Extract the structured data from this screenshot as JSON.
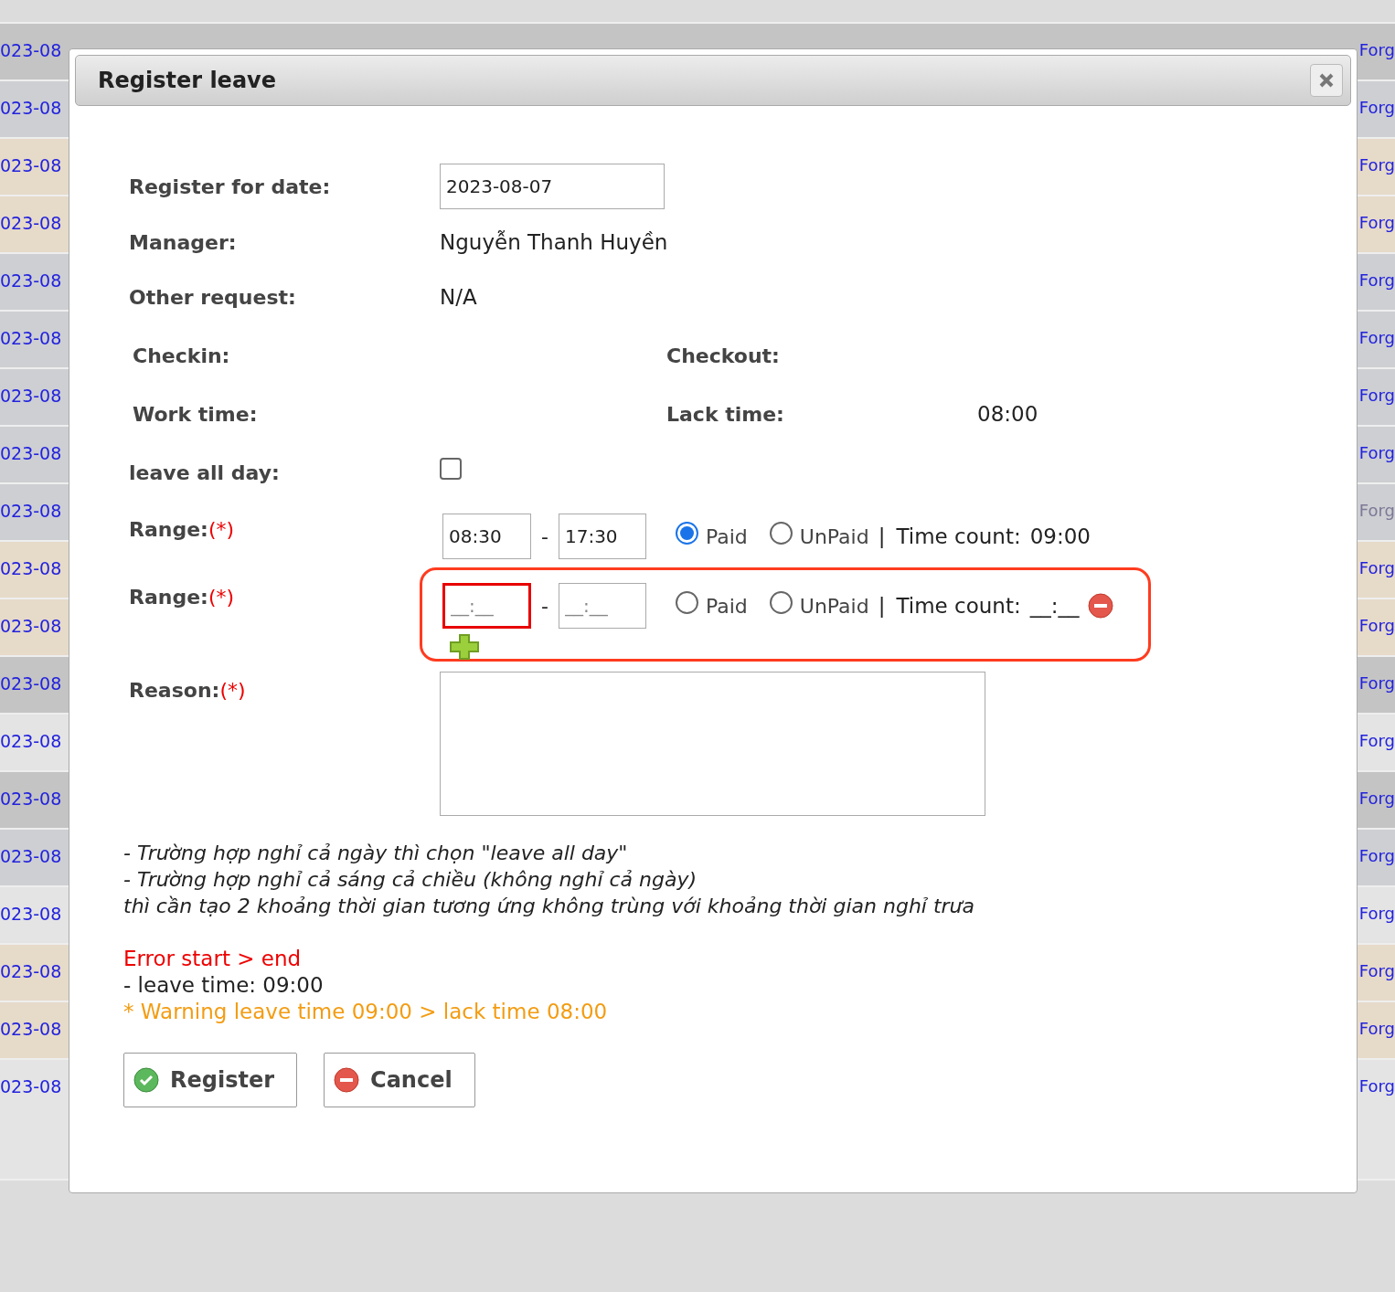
{
  "background_table": {
    "rows": [
      {
        "date": "023-08",
        "link": "Forg",
        "color": "#c4c4c4",
        "disabled": false
      },
      {
        "date": "023-08",
        "link": "Forg",
        "color": "#cdcfd3",
        "disabled": false
      },
      {
        "date": "023-08",
        "link": "Forg",
        "color": "#e6dac9",
        "disabled": false
      },
      {
        "date": "023-08",
        "link": "Forg",
        "color": "#e6dac9",
        "disabled": false
      },
      {
        "date": "023-08",
        "link": "Forg",
        "color": "#cdcfd3",
        "disabled": false
      },
      {
        "date": "023-08",
        "link": "Forg",
        "color": "#cdcfd3",
        "disabled": false
      },
      {
        "date": "023-08",
        "link": "Forg",
        "color": "#cdcfd3",
        "disabled": false
      },
      {
        "date": "023-08",
        "link": "Forg",
        "color": "#cdcfd3",
        "disabled": false
      },
      {
        "date": "023-08",
        "link": "Forg",
        "color": "#cdcfd3",
        "disabled": true
      },
      {
        "date": "023-08",
        "link": "Forg",
        "color": "#e6dac9",
        "disabled": false
      },
      {
        "date": "023-08",
        "link": "Forg",
        "color": "#e6dac9",
        "disabled": false
      },
      {
        "date": "023-08",
        "link": "Forg",
        "color": "#c4c4c4",
        "disabled": false
      },
      {
        "date": "023-08",
        "link": "Forg",
        "color": "#e4e4e4",
        "disabled": false
      },
      {
        "date": "023-08",
        "link": "Forg",
        "color": "#c4c4c4",
        "disabled": false
      },
      {
        "date": "023-08",
        "link": "Forg",
        "color": "#cdcfd3",
        "disabled": false
      },
      {
        "date": "023-08",
        "link": "Forg",
        "color": "#e4e4e4",
        "disabled": false
      },
      {
        "date": "023-08",
        "link": "Forg",
        "color": "#e6dac9",
        "disabled": false
      },
      {
        "date": "023-08",
        "link": "Forg",
        "color": "#e6dac9",
        "disabled": false
      },
      {
        "date": "023-08",
        "link": "Forg",
        "color": "#e4e4e4",
        "disabled": false
      }
    ]
  },
  "dialog": {
    "title": "Register leave",
    "register_date": {
      "label": "Register for date:",
      "value": "2023-08-07"
    },
    "manager": {
      "label": "Manager:",
      "value": "Nguyễn Thanh Huyền"
    },
    "other_request": {
      "label": "Other request:",
      "value": "N/A"
    },
    "checkin": {
      "label": "Checkin:"
    },
    "checkout": {
      "label": "Checkout:"
    },
    "work_time": {
      "label": "Work time:"
    },
    "lack_time": {
      "label": "Lack time:",
      "value": "08:00"
    },
    "leave_all_day": {
      "label": "leave all day:",
      "checked": false
    },
    "ranges": [
      {
        "label": "Range:",
        "required": "(*)",
        "start": "08:30",
        "end": "17:30",
        "separator": "-",
        "options": [
          {
            "label": "Paid",
            "selected": true
          },
          {
            "label": "UnPaid",
            "selected": false
          }
        ],
        "divider": "|",
        "time_count_label": "Time count:",
        "time_count": "09:00",
        "highlighted": false,
        "start_error": false,
        "removable": false,
        "addable": false
      },
      {
        "label": "Range:",
        "required": "(*)",
        "start_placeholder": "__:__",
        "end_placeholder": "__:__",
        "separator": "-",
        "options": [
          {
            "label": "Paid",
            "selected": false
          },
          {
            "label": "UnPaid",
            "selected": false
          }
        ],
        "divider": "|",
        "time_count_label": "Time count:",
        "time_count": "__:__",
        "highlighted": true,
        "start_error": true,
        "removable": true,
        "addable": true
      }
    ],
    "reason": {
      "label": "Reason:",
      "required": "(*)"
    },
    "notes": [
      "- Trường hợp nghỉ cả ngày thì chọn \"leave all day\"",
      "- Trường hợp nghỉ cả sáng cả chiều (không nghỉ cả ngày)",
      "thì cần tạo 2 khoảng thời gian tương ứng không trùng với khoảng thời gian nghỉ trưa"
    ],
    "messages": [
      {
        "kind": "error",
        "text": "Error start > end"
      },
      {
        "kind": "info",
        "text": "- leave time: 09:00"
      },
      {
        "kind": "warning",
        "text": "* Warning leave time 09:00 > lack time 08:00"
      }
    ],
    "buttons": [
      {
        "kind": "confirm",
        "label": "Register"
      },
      {
        "kind": "cancel",
        "label": "Cancel"
      }
    ]
  }
}
